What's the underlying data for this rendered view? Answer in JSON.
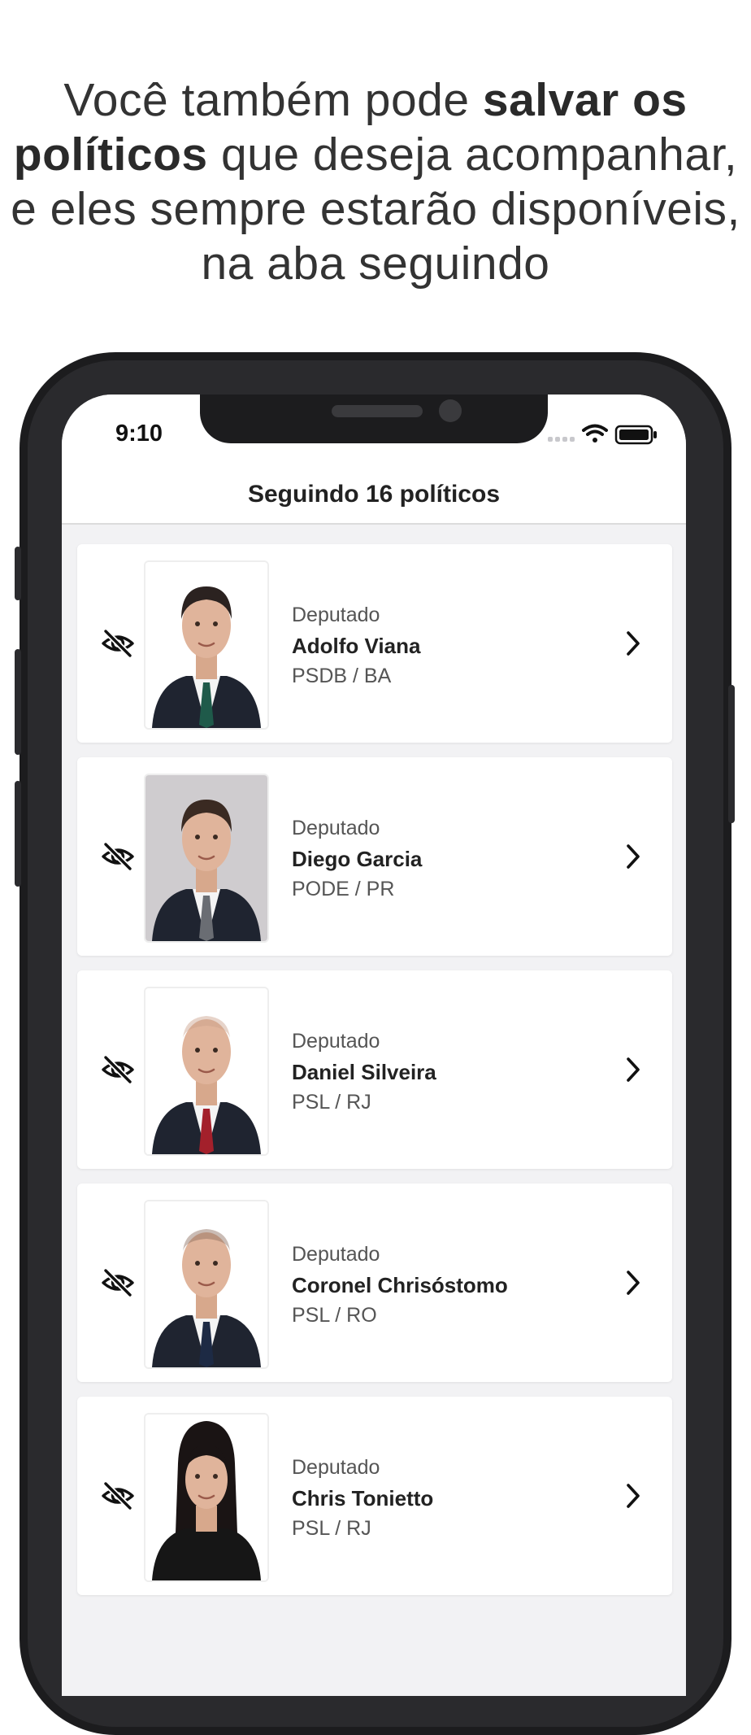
{
  "promo": {
    "line1_normal": "Você também pode ",
    "line1_bold": "salvar os",
    "line2_bold": "políticos",
    "line2_normal": " que deseja acompanhar,",
    "line3": "e eles sempre estarão disponíveis,",
    "line4": "na aba seguindo"
  },
  "status_bar": {
    "time": "9:10",
    "icons": [
      "signal-icon",
      "wifi-icon",
      "battery-icon"
    ]
  },
  "header": {
    "title": "Seguindo 16 políticos"
  },
  "politicians": [
    {
      "role": "Deputado",
      "name": "Adolfo Viana",
      "party": "PSDB / BA",
      "photo_bg": "#ffffff",
      "tie": "#1f5a4a",
      "hair": "#2b2220"
    },
    {
      "role": "Deputado",
      "name": "Diego Garcia",
      "party": "PODE / PR",
      "photo_bg": "#cfcccf",
      "tie": "#6a6d73",
      "hair": "#3a2a22"
    },
    {
      "role": "Deputado",
      "name": "Daniel Silveira",
      "party": "PSL / RJ",
      "photo_bg": "#ffffff",
      "tie": "#a3202b",
      "hair": "#c9a08a"
    },
    {
      "role": "Deputado",
      "name": "Coronel Chrisóstomo",
      "party": "PSL / RO",
      "photo_bg": "#ffffff",
      "tie": "#1d2a44",
      "hair": "#8a6a5a"
    },
    {
      "role": "Deputado",
      "name": "Chris Tonietto",
      "party": "PSL / RJ",
      "photo_bg": "#ffffff",
      "tie": "#1a1a1a",
      "hair": "#1a1414"
    }
  ],
  "colors": {
    "phone_frame": "#1c1c1e",
    "screen_bg": "#f2f2f4",
    "card_bg": "#ffffff",
    "text_primary": "#222222",
    "text_secondary": "#555555"
  }
}
